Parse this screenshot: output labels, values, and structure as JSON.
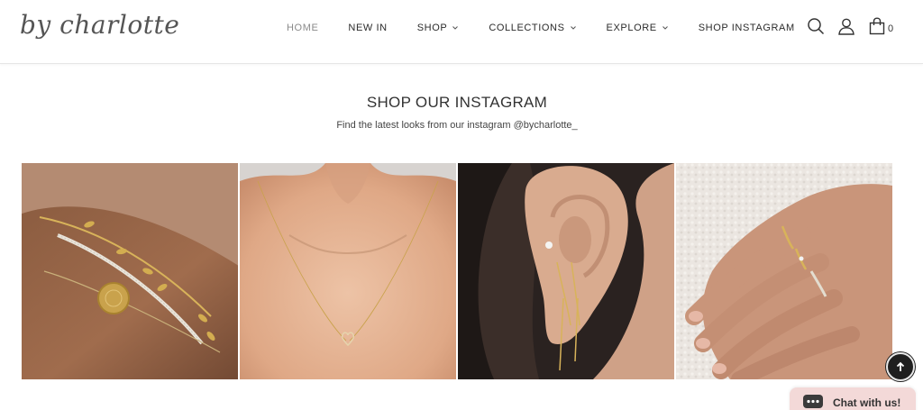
{
  "brand": {
    "logo_text": "by charlotte"
  },
  "nav": {
    "items": [
      {
        "label": "HOME",
        "active": true,
        "has_dropdown": false
      },
      {
        "label": "NEW IN",
        "active": false,
        "has_dropdown": false
      },
      {
        "label": "SHOP",
        "active": false,
        "has_dropdown": true
      },
      {
        "label": "COLLECTIONS",
        "active": false,
        "has_dropdown": true
      },
      {
        "label": "EXPLORE",
        "active": false,
        "has_dropdown": true
      },
      {
        "label": "SHOP INSTAGRAM",
        "active": false,
        "has_dropdown": false
      }
    ]
  },
  "header_icons": {
    "search": "search-icon",
    "account": "user-icon",
    "cart": "shopping-bag-icon",
    "cart_count": "0"
  },
  "section": {
    "title": "SHOP OUR INSTAGRAM",
    "subtitle": "Find the latest looks from our instagram @bycharlotte_"
  },
  "gallery": {
    "tiles": [
      {
        "subject": "bracelets-on-wrist"
      },
      {
        "subject": "heart-necklace"
      },
      {
        "subject": "ear-threader-earrings"
      },
      {
        "subject": "rings-on-hand"
      }
    ]
  },
  "widgets": {
    "back_to_top": "arrow-up-icon",
    "chat_label": "Chat with us!"
  },
  "colors": {
    "text": "#333333",
    "active_nav": "#8a8a8a",
    "chat_bg": "#f3d9d8",
    "to_top_bg": "#1f1f1f"
  }
}
